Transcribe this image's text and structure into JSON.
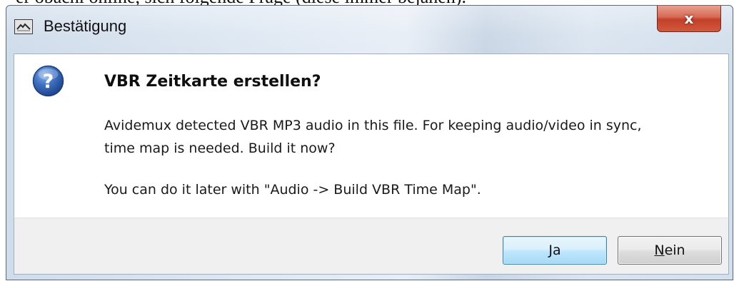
{
  "background_snippet": "er obachl online, sich folgende Frage (diese immer bejahen).",
  "window": {
    "title": "Bestätigung",
    "app_icon": "avidemux-icon",
    "close_label": "x"
  },
  "dialog": {
    "icon": "question-icon",
    "heading": "VBR Zeitkarte erstellen?",
    "message_line1": "Avidemux detected VBR MP3 audio in this file. For keeping audio/video in sync,",
    "message_line2": "time map is needed. Build it now?",
    "message_hint": "You can do it later with \"Audio -> Build VBR Time Map\"."
  },
  "buttons": {
    "yes_mnemonic": "J",
    "yes_rest": "a",
    "no_mnemonic": "N",
    "no_rest": "ein"
  },
  "colors": {
    "accent_button_border": "#3c7fb1",
    "close_button_red": "#c2402a",
    "question_icon_blue": "#2b5aa8"
  }
}
